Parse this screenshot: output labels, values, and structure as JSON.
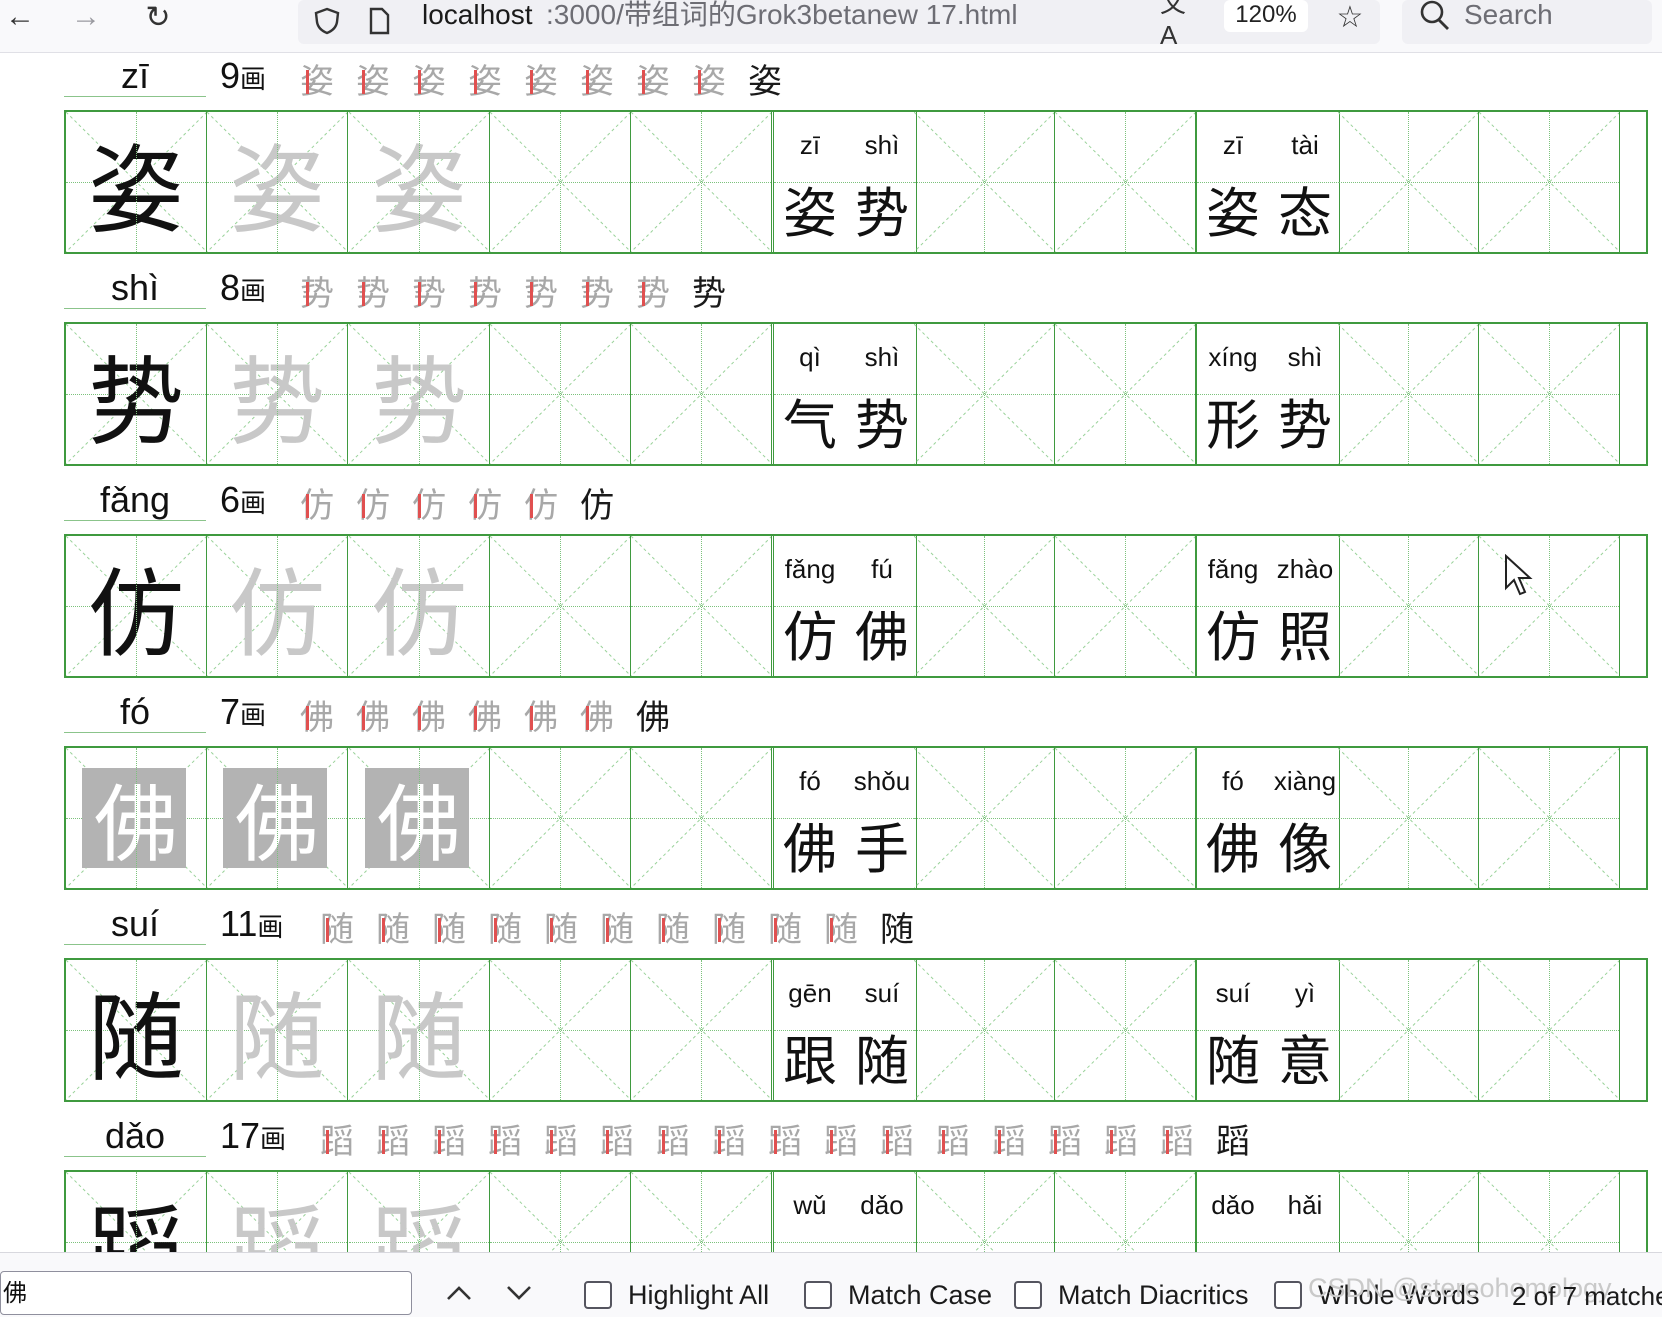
{
  "browser": {
    "url_host": "localhost",
    "url_path": ":3000/带组词的Grok3betanew 17.html",
    "zoom": "120%",
    "search_placeholder": "Search",
    "icons": [
      "back-arrow-icon",
      "forward-arrow-icon",
      "reload-icon",
      "shield-icon",
      "page-icon",
      "translate-icon",
      "star-icon",
      "search-icon"
    ]
  },
  "entries": [
    {
      "char": "姿",
      "pinyin": "zī",
      "strokes": "9",
      "stroke_char": "画",
      "steps": 9,
      "highlighted": false,
      "words": [
        {
          "py": [
            "zī",
            "shì"
          ],
          "hz": [
            "姿",
            "势"
          ]
        },
        {
          "py": [
            "zī",
            "tài"
          ],
          "hz": [
            "姿",
            "态"
          ]
        }
      ]
    },
    {
      "char": "势",
      "pinyin": "shì",
      "strokes": "8",
      "stroke_char": "画",
      "steps": 8,
      "highlighted": false,
      "words": [
        {
          "py": [
            "qì",
            "shì"
          ],
          "hz": [
            "气",
            "势"
          ]
        },
        {
          "py": [
            "xíng",
            "shì"
          ],
          "hz": [
            "形",
            "势"
          ]
        }
      ]
    },
    {
      "char": "仿",
      "pinyin": "fǎng",
      "strokes": "6",
      "stroke_char": "画",
      "steps": 6,
      "highlighted": false,
      "words": [
        {
          "py": [
            "fǎng",
            "fú"
          ],
          "hz": [
            "仿",
            "佛"
          ]
        },
        {
          "py": [
            "fǎng",
            "zhào"
          ],
          "hz": [
            "仿",
            "照"
          ]
        }
      ]
    },
    {
      "char": "佛",
      "pinyin": "fó",
      "strokes": "7",
      "stroke_char": "画",
      "steps": 7,
      "highlighted": true,
      "words": [
        {
          "py": [
            "fó",
            "shǒu"
          ],
          "hz": [
            "佛",
            "手"
          ]
        },
        {
          "py": [
            "fó",
            "xiàng"
          ],
          "hz": [
            "佛",
            "像"
          ]
        }
      ]
    },
    {
      "char": "随",
      "pinyin": "suí",
      "strokes": "11",
      "stroke_char": "画",
      "steps": 11,
      "highlighted": false,
      "words": [
        {
          "py": [
            "gēn",
            "suí"
          ],
          "hz": [
            "跟",
            "随"
          ]
        },
        {
          "py": [
            "suí",
            "yì"
          ],
          "hz": [
            "随",
            "意"
          ]
        }
      ]
    },
    {
      "char": "蹈",
      "pinyin": "dǎo",
      "strokes": "17",
      "stroke_char": "画",
      "steps": 17,
      "highlighted": false,
      "words": [
        {
          "py": [
            "wǔ",
            "dǎo"
          ],
          "hz": [
            "",
            ""
          ]
        },
        {
          "py": [
            "dǎo",
            "hǎi"
          ],
          "hz": [
            "",
            ""
          ]
        }
      ]
    }
  ],
  "colors": {
    "grid": "#3f9a3f",
    "dotted": "#7cc27c",
    "stroke_current": "#e05050",
    "highlight": "#b3b3b3"
  },
  "findbar": {
    "query": "佛",
    "options": [
      "Highlight All",
      "Match Case",
      "Match Diacritics",
      "Whole Words"
    ],
    "count": "2 of 7 matche",
    "watermark": "CSDN @stereohomology"
  }
}
